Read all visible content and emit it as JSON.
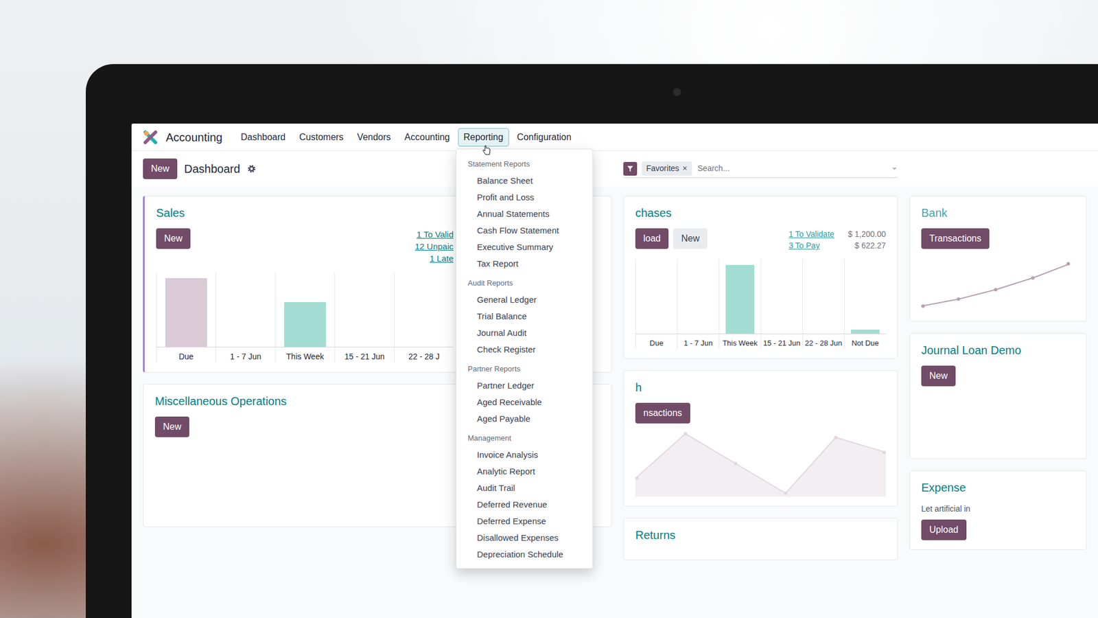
{
  "app": {
    "name": "Accounting"
  },
  "nav": {
    "items": [
      {
        "label": "Dashboard",
        "selected": false
      },
      {
        "label": "Customers",
        "selected": false
      },
      {
        "label": "Vendors",
        "selected": false
      },
      {
        "label": "Accounting",
        "selected": false
      },
      {
        "label": "Reporting",
        "selected": true
      },
      {
        "label": "Configuration",
        "selected": false
      }
    ]
  },
  "control": {
    "new_button": "New",
    "title": "Dashboard"
  },
  "search": {
    "facet": "Favorites",
    "facet_remove": "×",
    "placeholder": "Search..."
  },
  "reporting_menu": {
    "open": true,
    "sections": [
      {
        "title": "Statement Reports",
        "items": [
          "Balance Sheet",
          "Profit and Loss",
          "Annual Statements",
          "Cash Flow Statement",
          "Executive Summary",
          "Tax Report"
        ]
      },
      {
        "title": "Audit Reports",
        "items": [
          "General Ledger",
          "Trial Balance",
          "Journal Audit",
          "Check Register"
        ]
      },
      {
        "title": "Partner Reports",
        "items": [
          "Partner Ledger",
          "Aged Receivable",
          "Aged Payable"
        ]
      },
      {
        "title": "Management",
        "items": [
          "Invoice Analysis",
          "Analytic Report",
          "Audit Trail",
          "Deferred Revenue",
          "Deferred Expense",
          "Disallowed Expenses",
          "Depreciation Schedule"
        ]
      }
    ]
  },
  "sales": {
    "title": "Sales",
    "favorite": true,
    "button": "New",
    "stats": [
      "1 To Valid",
      "12 Unpaic",
      "1 Late"
    ],
    "chart": {
      "bars": [
        {
          "label": "Due",
          "value": 65,
          "color": "#d9cad6"
        },
        {
          "label": "1 - 7 Jun",
          "value": 0,
          "color": "#a3dcd2"
        },
        {
          "label": "This Week",
          "value": 42,
          "color": "#a3dcd2"
        },
        {
          "label": "15 - 21 Jun",
          "value": 0,
          "color": "#a3dcd2"
        },
        {
          "label": "22 - 28 J",
          "value": 0,
          "color": "#a3dcd2"
        }
      ]
    }
  },
  "misc": {
    "title": "Miscellaneous Operations",
    "button": "New"
  },
  "purchases": {
    "title": "chases",
    "buttons": [
      {
        "label": "load",
        "kind": "primary"
      },
      {
        "label": "New",
        "kind": "secondary"
      }
    ],
    "stats": [
      {
        "label": "1 To Validate",
        "amount": "$ 1,200.00"
      },
      {
        "label": "3 To Pay",
        "amount": "$ 622.27"
      }
    ],
    "chart": {
      "bars": [
        {
          "label": "Due",
          "value": 0,
          "color": "#a3dcd2"
        },
        {
          "label": "1 - 7 Jun",
          "value": 0,
          "color": "#a3dcd2"
        },
        {
          "label": "This Week",
          "value": 110,
          "color": "#a3dcd2"
        },
        {
          "label": "15 - 21 Jun",
          "value": 0,
          "color": "#a3dcd2"
        },
        {
          "label": "22 - 28 Jun",
          "value": 0,
          "color": "#a3dcd2"
        },
        {
          "label": "Not Due",
          "value": 6,
          "color": "#a3dcd2"
        }
      ]
    }
  },
  "bank_cash": {
    "title": "h",
    "button": "nsactions",
    "chart": {
      "values": [
        20,
        80,
        40,
        0,
        75,
        55
      ]
    }
  },
  "returns": {
    "title": "Returns"
  },
  "bank": {
    "title": "Bank",
    "button": "Transactions",
    "chart": {
      "values": [
        0,
        12,
        28,
        48,
        72
      ]
    }
  },
  "journal_loan": {
    "title": "Journal Loan Demo",
    "button": "New"
  },
  "expense": {
    "title": "Expense",
    "text": "Let artificial in",
    "button": "Upload"
  }
}
